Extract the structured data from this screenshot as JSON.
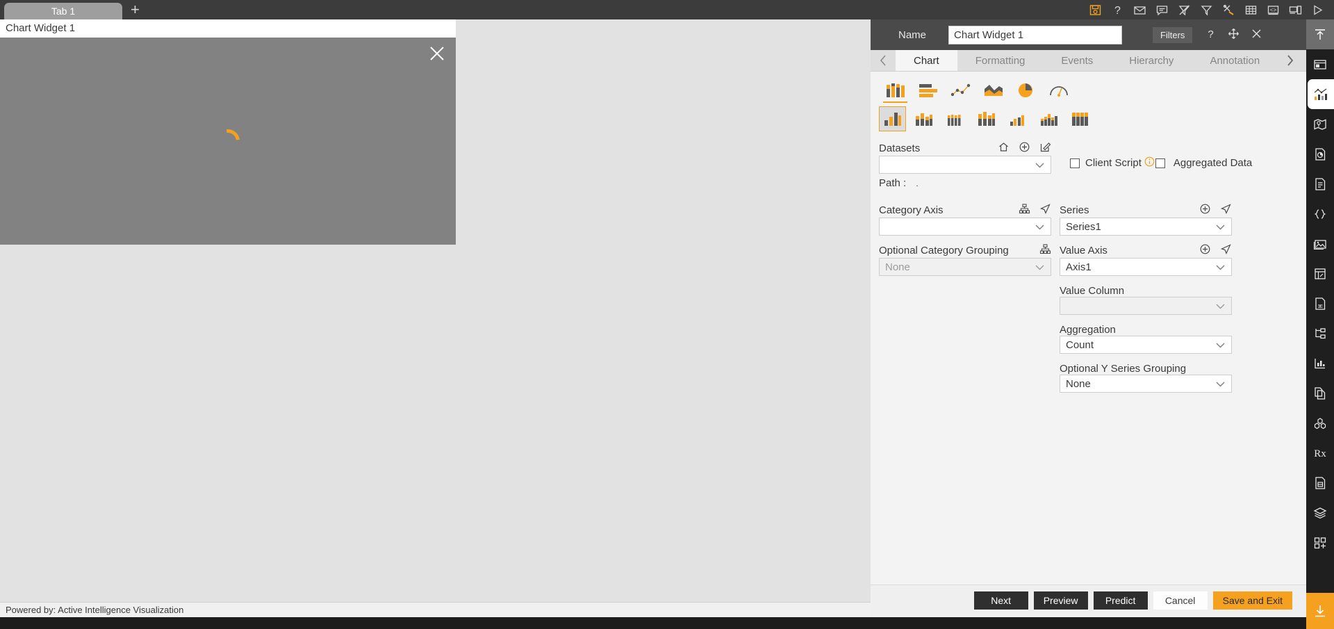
{
  "topbar": {
    "tabs": [
      {
        "label": "Tab 1"
      }
    ],
    "add_tab_label": "+",
    "icons": [
      "save-icon",
      "help-icon",
      "mail-icon",
      "comment-icon",
      "clear-filter-icon",
      "filter-icon",
      "tools-icon",
      "table-icon",
      "code-icon",
      "devices-icon",
      "play-icon"
    ]
  },
  "canvas": {
    "widget": {
      "title": "Chart Widget 1",
      "close_label": "×",
      "state": "loading"
    }
  },
  "footer": {
    "text": "Powered by: Active Intelligence Visualization"
  },
  "sidebar": {
    "items": [
      {
        "name": "collapse-up-icon",
        "state": "active-gray"
      },
      {
        "name": "layout-icon",
        "state": "normal"
      },
      {
        "name": "chart-icon",
        "state": "active-white"
      },
      {
        "name": "map-icon",
        "state": "normal"
      },
      {
        "name": "report-pie-icon",
        "state": "normal"
      },
      {
        "name": "document-icon",
        "state": "normal"
      },
      {
        "name": "braces-icon",
        "state": "normal"
      },
      {
        "name": "image-icon",
        "state": "normal"
      },
      {
        "name": "form-icon",
        "state": "normal"
      },
      {
        "name": "file-grid-icon",
        "state": "normal"
      },
      {
        "name": "tree-icon",
        "state": "normal"
      },
      {
        "name": "analytics-icon",
        "state": "normal"
      },
      {
        "name": "copy-file-icon",
        "state": "normal"
      },
      {
        "name": "cubes-icon",
        "state": "normal"
      },
      {
        "name": "prescription-icon",
        "state": "normal"
      },
      {
        "name": "save-file-icon",
        "state": "normal"
      },
      {
        "name": "layers-icon",
        "state": "normal"
      },
      {
        "name": "add-widget-icon",
        "state": "normal"
      },
      {
        "name": "download-icon",
        "state": "orange"
      }
    ]
  },
  "panel": {
    "header": {
      "name_label": "Name",
      "name_value": "Chart Widget 1",
      "name_placeholder": "",
      "filters_label": "Filters",
      "icons": [
        "help-icon",
        "move-icon",
        "close-icon"
      ]
    },
    "tabs": {
      "prev_label": "‹",
      "next_label": "›",
      "items": [
        {
          "label": "Chart",
          "active": true
        },
        {
          "label": "Formatting",
          "active": false
        },
        {
          "label": "Events",
          "active": false
        },
        {
          "label": "Hierarchy",
          "active": false
        },
        {
          "label": "Annotation",
          "active": false
        }
      ]
    },
    "chart_types_primary": [
      {
        "name": "column-chart-icon",
        "selected": true
      },
      {
        "name": "bar-chart-icon",
        "selected": false
      },
      {
        "name": "scatter-line-chart-icon",
        "selected": false
      },
      {
        "name": "area-chart-icon",
        "selected": false
      },
      {
        "name": "pie-chart-icon",
        "selected": false
      },
      {
        "name": "gauge-chart-icon",
        "selected": false
      }
    ],
    "chart_types_secondary": [
      {
        "name": "clustered-column-icon",
        "selected": true
      },
      {
        "name": "stacked-column-icon",
        "selected": false
      },
      {
        "name": "multi-stacked-column-icon",
        "selected": false
      },
      {
        "name": "stacked-100-column-icon",
        "selected": false
      },
      {
        "name": "overlapped-column-icon",
        "selected": false
      },
      {
        "name": "waterfall-column-icon",
        "selected": false
      },
      {
        "name": "grouped-stacked-column-icon",
        "selected": false
      }
    ],
    "datasets": {
      "label": "Datasets",
      "value": "",
      "placeholder": "",
      "icons": [
        "home-icon",
        "add-icon",
        "edit-icon"
      ],
      "path_label": "Path :",
      "path_value": "."
    },
    "client_script": {
      "label": "Client Script",
      "checked": false,
      "info_icon": "info-icon"
    },
    "aggregated_data": {
      "label": "Aggregated Data",
      "checked": false
    },
    "category_axis": {
      "label": "Category Axis",
      "value": "",
      "icons": [
        "hierarchy-icon",
        "send-icon"
      ]
    },
    "optional_category_grouping": {
      "label": "Optional Category Grouping",
      "value": "None",
      "icons": [
        "hierarchy-icon"
      ]
    },
    "series": {
      "label": "Series",
      "value": "Series1",
      "icons": [
        "add-icon",
        "send-icon"
      ]
    },
    "value_axis": {
      "label": "Value Axis",
      "value": "Axis1",
      "icons": [
        "add-icon",
        "send-icon"
      ]
    },
    "value_column": {
      "label": "Value Column",
      "value": ""
    },
    "aggregation": {
      "label": "Aggregation",
      "value": "Count"
    },
    "optional_y_series_grouping": {
      "label": "Optional Y Series Grouping",
      "value": "None"
    },
    "buttons": [
      {
        "label": "Next",
        "style": "dark"
      },
      {
        "label": "Preview",
        "style": "dark"
      },
      {
        "label": "Predict",
        "style": "dark"
      },
      {
        "label": "Cancel",
        "style": "light"
      },
      {
        "label": "Save and Exit",
        "style": "orange"
      }
    ]
  },
  "colors": {
    "accent": "#f5a01e",
    "panel_header": "#4a4a4a",
    "topbar": "#3c3c3c",
    "sidebar": "#1f1f1f"
  }
}
